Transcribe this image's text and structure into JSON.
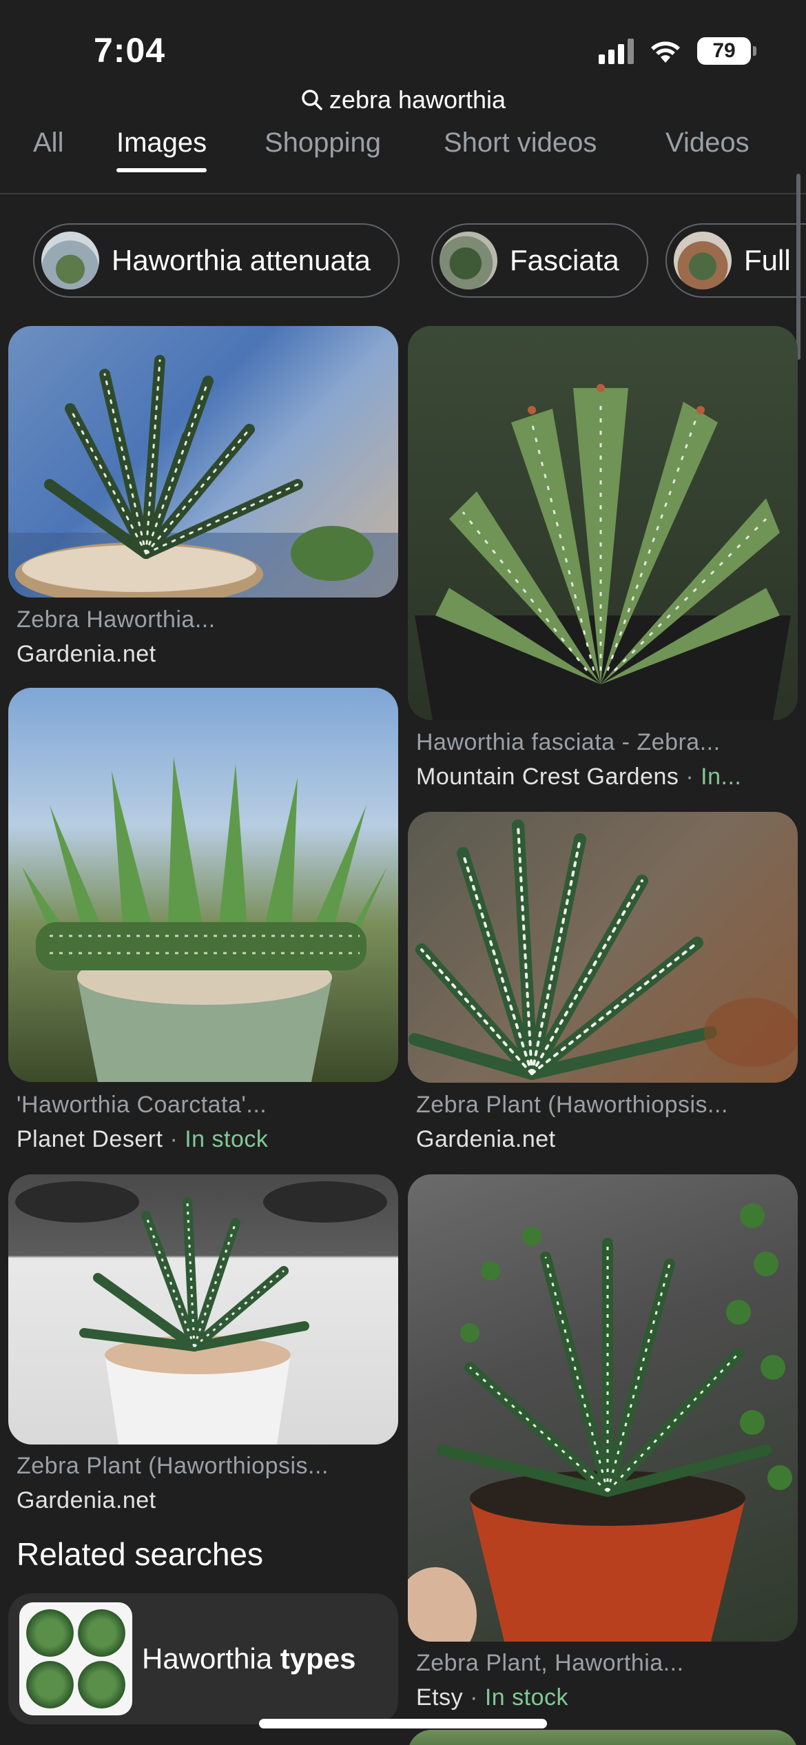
{
  "status_bar": {
    "time": "7:04",
    "battery": "79"
  },
  "search": {
    "query": "zebra haworthia"
  },
  "tabs": [
    {
      "label": "All"
    },
    {
      "label": "Images"
    },
    {
      "label": "Shopping"
    },
    {
      "label": "Short videos"
    },
    {
      "label": "Videos"
    }
  ],
  "chips": [
    {
      "label": "Haworthia attenuata"
    },
    {
      "label": "Fasciata"
    },
    {
      "label": "Full"
    }
  ],
  "results": [
    {
      "title": "Zebra Haworthia...",
      "source": "Gardenia.net",
      "stock": ""
    },
    {
      "title": "Haworthia fasciata - Zebra...",
      "source": "Mountain Crest Gardens",
      "sep": "·",
      "stock": "In..."
    },
    {
      "title": "'Haworthia Coarctata'...",
      "source": "Planet Desert",
      "sep": "·",
      "stock": "In stock"
    },
    {
      "title": "Zebra Plant (Haworthiopsis...",
      "source": "Gardenia.net",
      "stock": ""
    },
    {
      "title": "Zebra Plant (Haworthiopsis...",
      "source": "Gardenia.net",
      "stock": ""
    },
    {
      "title": "Zebra Plant, Haworthia...",
      "source": "Etsy",
      "sep": "·",
      "stock": "In stock"
    }
  ],
  "related": {
    "title": "Related searches",
    "items": [
      {
        "label_plain": "Haworthia ",
        "label_bold": "types"
      }
    ]
  },
  "colors": {
    "background": "#1f1f1f",
    "in_stock": "#81c995",
    "muted": "#9aa0a6"
  }
}
